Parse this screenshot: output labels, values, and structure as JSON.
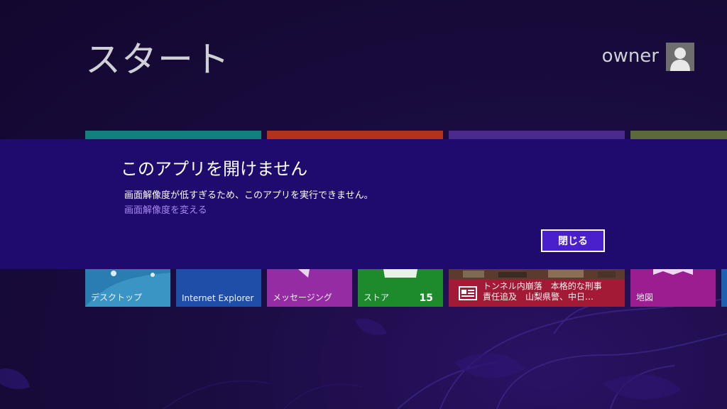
{
  "start": {
    "title": "スタート"
  },
  "user": {
    "name": "owner",
    "avatar_icon": "user-silhouette-icon"
  },
  "tiles": {
    "desktop": {
      "label": "デスクトップ",
      "color": "#1c6f8a"
    },
    "ie": {
      "label": "Internet Explorer",
      "color": "#1d4fa8"
    },
    "messaging": {
      "label": "メッセージング",
      "color": "#962ca3"
    },
    "store": {
      "label": "ストア",
      "badge": "15",
      "color": "#1d8a2b"
    },
    "news": {
      "line1": "トンネル内崩落　本格的な刑事",
      "line2": "責任追及　山梨県警、中日…",
      "color": "#a21a36",
      "icon": "newspaper-icon"
    },
    "maps": {
      "label": "地図",
      "color": "#9b1d8f"
    }
  },
  "dialog": {
    "title": "このアプリを開けません",
    "message": "画面解像度が低すぎるため、このアプリを実行できません。",
    "link": "画面解像度を変える",
    "close_label": "閉じる"
  },
  "colors": {
    "dialog_bg": "#1f0a6e",
    "link": "#a889f5",
    "button_bg": "#4a1fcc"
  }
}
